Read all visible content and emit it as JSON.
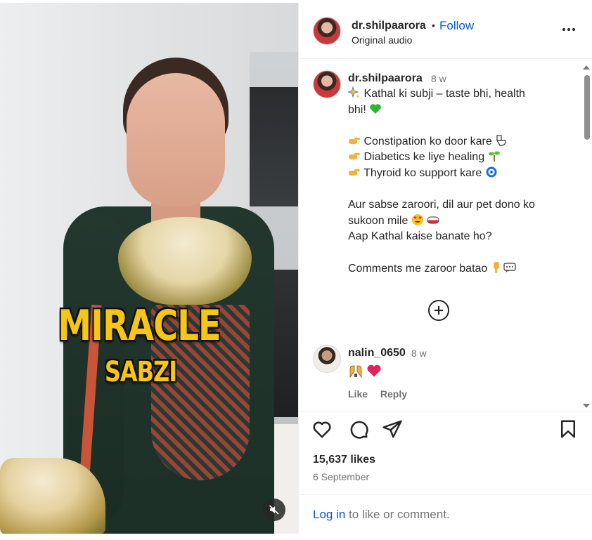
{
  "post": {
    "author": "dr.shilpaarora",
    "follow_label": "Follow",
    "audio_label": "Original audio",
    "separator": "•",
    "overlay_line1": "MIRACLE",
    "overlay_line2": "SABZI"
  },
  "caption": {
    "author": "dr.shilpaarora",
    "time": "8 w",
    "lines": [
      "Kathal ki subji – taste bhi, health",
      "bhi!",
      "",
      "Constipation ko door kare",
      "Diabetics ke liye healing",
      "Thyroid ko support kare",
      "",
      "Aur sabse zaroori, dil aur pet dono ko",
      "sukoon mile",
      "Aap Kathal kaise banate ho?",
      "",
      "Comments me zaroor batao"
    ],
    "emoji_names": [
      "sparkles-icon",
      "green-heart-icon",
      "pointing-hand-icon",
      "toilet-icon",
      "sprout-icon",
      "nazar-amulet-icon",
      "heart-eyes-icon",
      "pill-icon",
      "pointing-down-icon",
      "speech-bubble-icon"
    ]
  },
  "load_more": {
    "icon": "plus-circle-icon"
  },
  "reply": {
    "author": "nalin_0650",
    "time": "8 w",
    "emojis": [
      "raising-hands-icon",
      "red-heart-icon"
    ],
    "like_label": "Like",
    "reply_label": "Reply"
  },
  "actions": {
    "like_icon": "heart-icon",
    "comment_icon": "comment-icon",
    "share_icon": "send-icon",
    "save_icon": "bookmark-icon"
  },
  "stats": {
    "likes": "15,637 likes",
    "date": "6 September"
  },
  "login": {
    "link_label": "Log in",
    "rest_label": " to like or comment."
  },
  "media": {
    "mute_icon": "speaker-muted-icon"
  },
  "colors": {
    "link_blue": "#0a58ca",
    "text": "#262626",
    "muted": "#737373",
    "overlay_yellow": "#f5c518"
  }
}
